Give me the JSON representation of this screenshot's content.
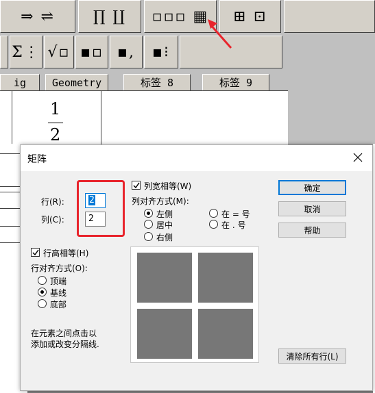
{
  "toolbar": {
    "row1": [
      {
        "label": "⇒ ⇌"
      },
      {
        "label": "∏ ∐"
      },
      {
        "label": "▫▫▫ ▦"
      },
      {
        "label": "⊞ ⊡"
      }
    ],
    "row2": [
      {
        "label": "Σ⋮"
      },
      {
        "label": "√▫"
      },
      {
        "label": "▪▫"
      },
      {
        "label": "▪,"
      },
      {
        "label": "▪⁝"
      }
    ],
    "tabs": [
      "ig",
      "Geometry",
      "标签 8",
      "标签 9"
    ],
    "fraction_numerator": "1",
    "fraction_denominator": "2"
  },
  "dialog": {
    "title": "矩阵",
    "rows_label": "行(R):",
    "rows_value": "2",
    "cols_label": "列(C):",
    "cols_value": "2",
    "equal_col_width_label": "列宽相等(W)",
    "equal_col_width_checked": true,
    "col_align_label": "列对齐方式(M):",
    "col_align_options": [
      "左侧",
      "居中",
      "右侧",
      "在 = 号",
      "在 . 号"
    ],
    "col_align_selected": "左侧",
    "equal_row_height_label": "行高相等(H)",
    "equal_row_height_checked": true,
    "row_align_label": "行对齐方式(O):",
    "row_align_options": [
      "顶端",
      "基线",
      "底部"
    ],
    "row_align_selected": "基线",
    "hint_line1": "在元素之间点击以",
    "hint_line2": "添加或改变分隔线.",
    "ok_label": "确定",
    "cancel_label": "取消",
    "help_label": "帮助",
    "clear_rows_label": "清除所有行(L)"
  },
  "colors": {
    "highlight": "#e8242c",
    "focus": "#0078d7",
    "preview_cell": "#777777"
  }
}
